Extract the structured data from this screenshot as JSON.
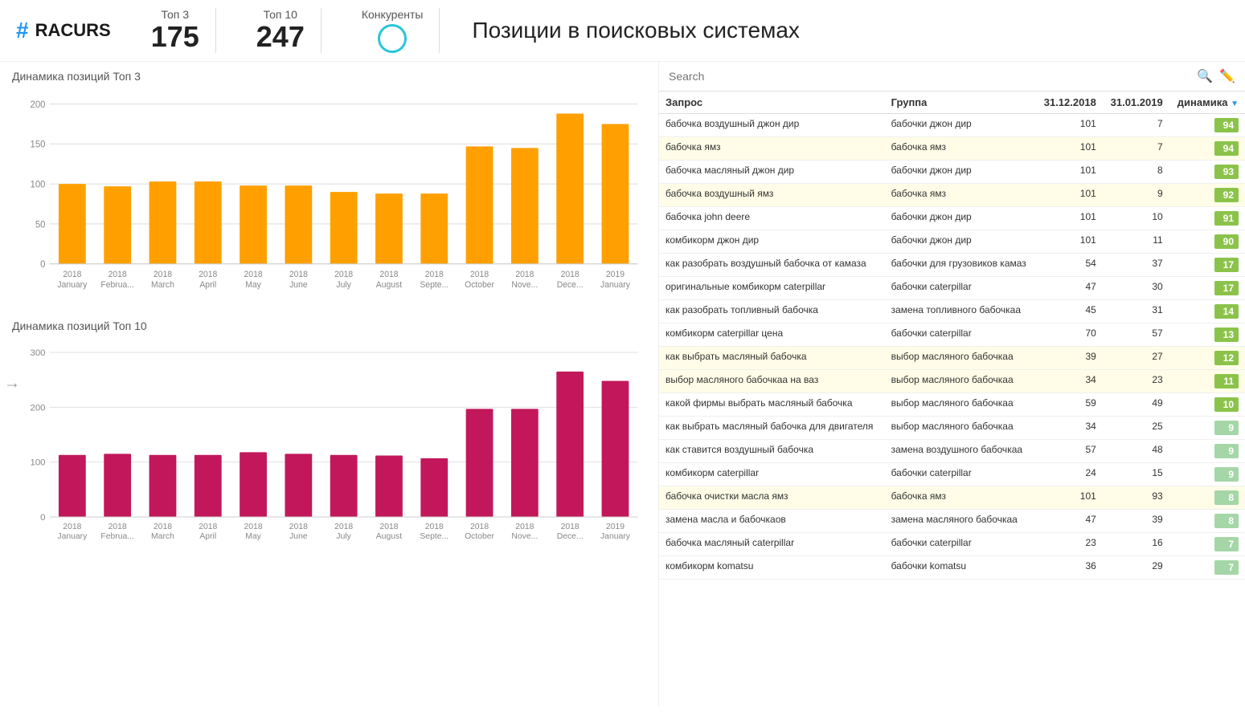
{
  "header": {
    "logo_hash": "#",
    "logo_name": "RACURS",
    "top3_label": "Топ 3",
    "top3_value": "175",
    "top10_label": "Топ 10",
    "top10_value": "247",
    "konkurenty_label": "Конкуренты",
    "page_title": "Позиции в поисковых системах"
  },
  "search": {
    "placeholder": "Search"
  },
  "charts": {
    "chart1_title": "Динамика позиций Топ 3",
    "chart2_title": "Динамика позиций Топ 10"
  },
  "table": {
    "col_query": "Запрос",
    "col_group": "Группа",
    "col_date1": "31.12.2018",
    "col_date2": "31.01.2019",
    "col_dyn": "динамика",
    "rows": [
      {
        "query": "бабочка воздушный джон дир",
        "group": "бабочки джон дир",
        "d1": 101,
        "d2": 7,
        "dyn": 94,
        "yellow": false
      },
      {
        "query": "бабочка ямз",
        "group": "бабочка ямз",
        "d1": 101,
        "d2": 7,
        "dyn": 94,
        "yellow": true
      },
      {
        "query": "бабочка масляный джон дир",
        "group": "бабочки джон дир",
        "d1": 101,
        "d2": 8,
        "dyn": 93,
        "yellow": false
      },
      {
        "query": "бабочка воздушный ямз",
        "group": "бабочка ямз",
        "d1": 101,
        "d2": 9,
        "dyn": 92,
        "yellow": true
      },
      {
        "query": "бабочка john deere",
        "group": "бабочки джон дир",
        "d1": 101,
        "d2": 10,
        "dyn": 91,
        "yellow": false
      },
      {
        "query": "комбикорм джон дир",
        "group": "бабочки джон дир",
        "d1": 101,
        "d2": 11,
        "dyn": 90,
        "yellow": false
      },
      {
        "query": "как разобрать воздушный бабочка от камаза",
        "group": "бабочки для грузовиков камаз",
        "d1": 54,
        "d2": 37,
        "dyn": 17,
        "yellow": false
      },
      {
        "query": "оригинальные комбикорм caterpillar",
        "group": "бабочки caterpillar",
        "d1": 47,
        "d2": 30,
        "dyn": 17,
        "yellow": false
      },
      {
        "query": "как разобрать топливный бабочка",
        "group": "замена топливного бабочкаа",
        "d1": 45,
        "d2": 31,
        "dyn": 14,
        "yellow": false
      },
      {
        "query": "комбикорм caterpillar цена",
        "group": "бабочки caterpillar",
        "d1": 70,
        "d2": 57,
        "dyn": 13,
        "yellow": false
      },
      {
        "query": "как выбрать масляный бабочка",
        "group": "выбор масляного бабочкаа",
        "d1": 39,
        "d2": 27,
        "dyn": 12,
        "yellow": true
      },
      {
        "query": "выбор масляного бабочкаа на ваз",
        "group": "выбор масляного бабочкаа",
        "d1": 34,
        "d2": 23,
        "dyn": 11,
        "yellow": true
      },
      {
        "query": "какой фирмы выбрать масляный бабочка",
        "group": "выбор масляного бабочкаа",
        "d1": 59,
        "d2": 49,
        "dyn": 10,
        "yellow": false
      },
      {
        "query": "как выбрать масляный бабочка для двигателя",
        "group": "выбор масляного бабочкаа",
        "d1": 34,
        "d2": 25,
        "dyn": 9,
        "yellow": false
      },
      {
        "query": "как ставится воздушный бабочка",
        "group": "замена воздушного бабочкаа",
        "d1": 57,
        "d2": 48,
        "dyn": 9,
        "yellow": false
      },
      {
        "query": "комбикорм caterpillar",
        "group": "бабочки caterpillar",
        "d1": 24,
        "d2": 15,
        "dyn": 9,
        "yellow": false
      },
      {
        "query": "бабочка очистки масла ямз",
        "group": "бабочка ямз",
        "d1": 101,
        "d2": 93,
        "dyn": 8,
        "yellow": true
      },
      {
        "query": "замена масла и бабочкаов",
        "group": "замена масляного бабочкаа",
        "d1": 47,
        "d2": 39,
        "dyn": 8,
        "yellow": false
      },
      {
        "query": "бабочка масляный caterpillar",
        "group": "бабочки caterpillar",
        "d1": 23,
        "d2": 16,
        "dyn": 7,
        "yellow": false
      },
      {
        "query": "комбикорм komatsu",
        "group": "бабочки komatsu",
        "d1": 36,
        "d2": 29,
        "dyn": 7,
        "yellow": false
      }
    ]
  },
  "chart1_bars": [
    100,
    97,
    103,
    103,
    98,
    98,
    90,
    88,
    88,
    147,
    145,
    188,
    175
  ],
  "chart2_bars": [
    113,
    115,
    113,
    113,
    118,
    115,
    113,
    112,
    107,
    197,
    197,
    265,
    248
  ],
  "bar_labels": [
    "2018\nJanuary",
    "2018\nFebrua...",
    "2018\nMarch",
    "2018\nApril",
    "2018\nMay",
    "2018\nJune",
    "2018\nJuly",
    "2018\nAugust",
    "2018\nSepte...",
    "2018\nOctober",
    "2018\nNove...",
    "2018\nDece...",
    "2019\nJanuary"
  ]
}
